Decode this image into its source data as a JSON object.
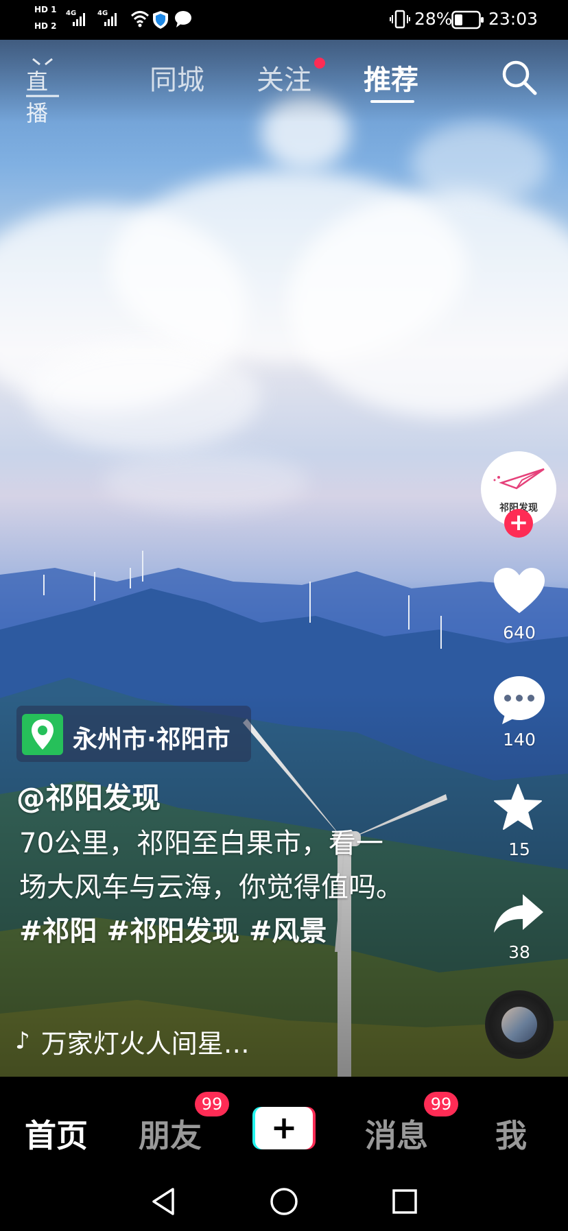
{
  "status_bar": {
    "hd1": "HD 1",
    "hd2": "HD 2",
    "net1": "4G",
    "net2": "4G",
    "battery_pct": "28%",
    "time": "23:03"
  },
  "top_nav": {
    "live_label": "直播",
    "tabs": [
      {
        "label": "同城"
      },
      {
        "label": "关注"
      },
      {
        "label": "推荐"
      }
    ],
    "active_tab": "推荐"
  },
  "creator": {
    "avatar_text": "祁阳发现",
    "follow_symbol": "+"
  },
  "actions": {
    "likes": "640",
    "comments": "140",
    "favorites": "15",
    "shares": "38"
  },
  "caption": {
    "location": "永州市·祁阳市",
    "author": "@祁阳发现",
    "description": "70公里，祁阳至白果市，看一场大风车与云海，你觉得值吗。",
    "hashtags": "#祁阳 #祁阳发现 #风景",
    "music": "万家灯火人间星…"
  },
  "tab_bar": {
    "home": "首页",
    "friends": "朋友",
    "friends_badge": "99",
    "create": "+",
    "messages": "消息",
    "messages_badge": "99",
    "me": "我"
  },
  "colors": {
    "accent": "#fe2c55",
    "cyan": "#25f4ee",
    "location_green": "#26c05a"
  }
}
